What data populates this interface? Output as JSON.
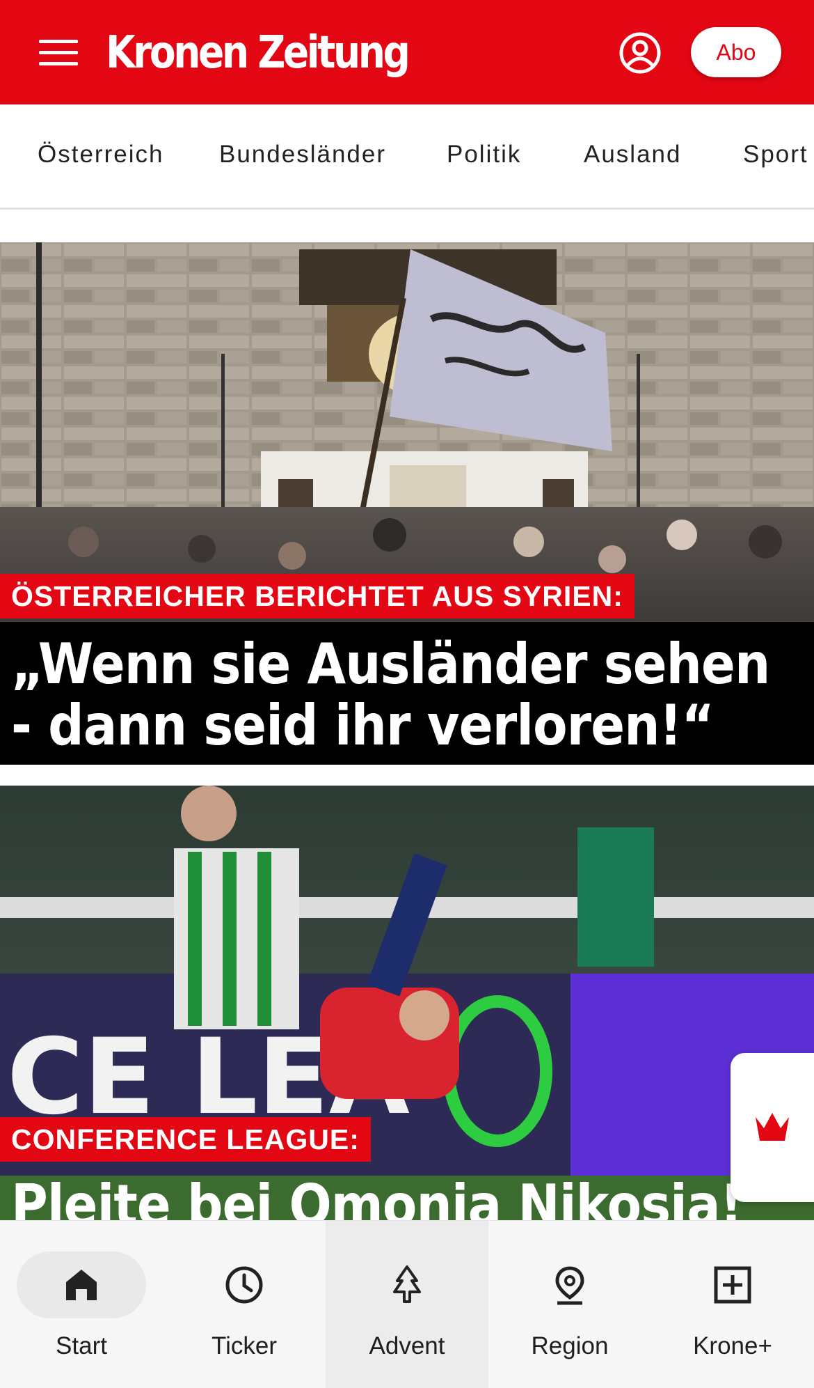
{
  "header": {
    "logo": "Kronen Zeitung",
    "abo_label": "Abo",
    "brand_color": "#e30613"
  },
  "categories": [
    "Österreich",
    "Bundesländer",
    "Politik",
    "Ausland",
    "Sport"
  ],
  "articles": [
    {
      "kicker": "ÖSTERREICHER BERICHTET AUS SYRIEN:",
      "headline_line1": "„Wenn sie Ausländer sehen",
      "headline_line2": "- dann seid ihr verloren!“",
      "image": "crowd-with-flag-in-front-of-mosque-photo"
    },
    {
      "kicker": "CONFERENCE LEAGUE:",
      "headline_line1": "Pleite bei Omonia Nikosia!",
      "image": "football-match-photo"
    }
  ],
  "bottom_nav": [
    {
      "label": "Start",
      "icon": "home-icon",
      "selected": true
    },
    {
      "label": "Ticker",
      "icon": "clock-icon",
      "selected": false
    },
    {
      "label": "Advent",
      "icon": "tree-icon",
      "selected": false
    },
    {
      "label": "Region",
      "icon": "location-pin-icon",
      "selected": false
    },
    {
      "label": "Krone+",
      "icon": "plus-box-icon",
      "selected": false
    }
  ]
}
